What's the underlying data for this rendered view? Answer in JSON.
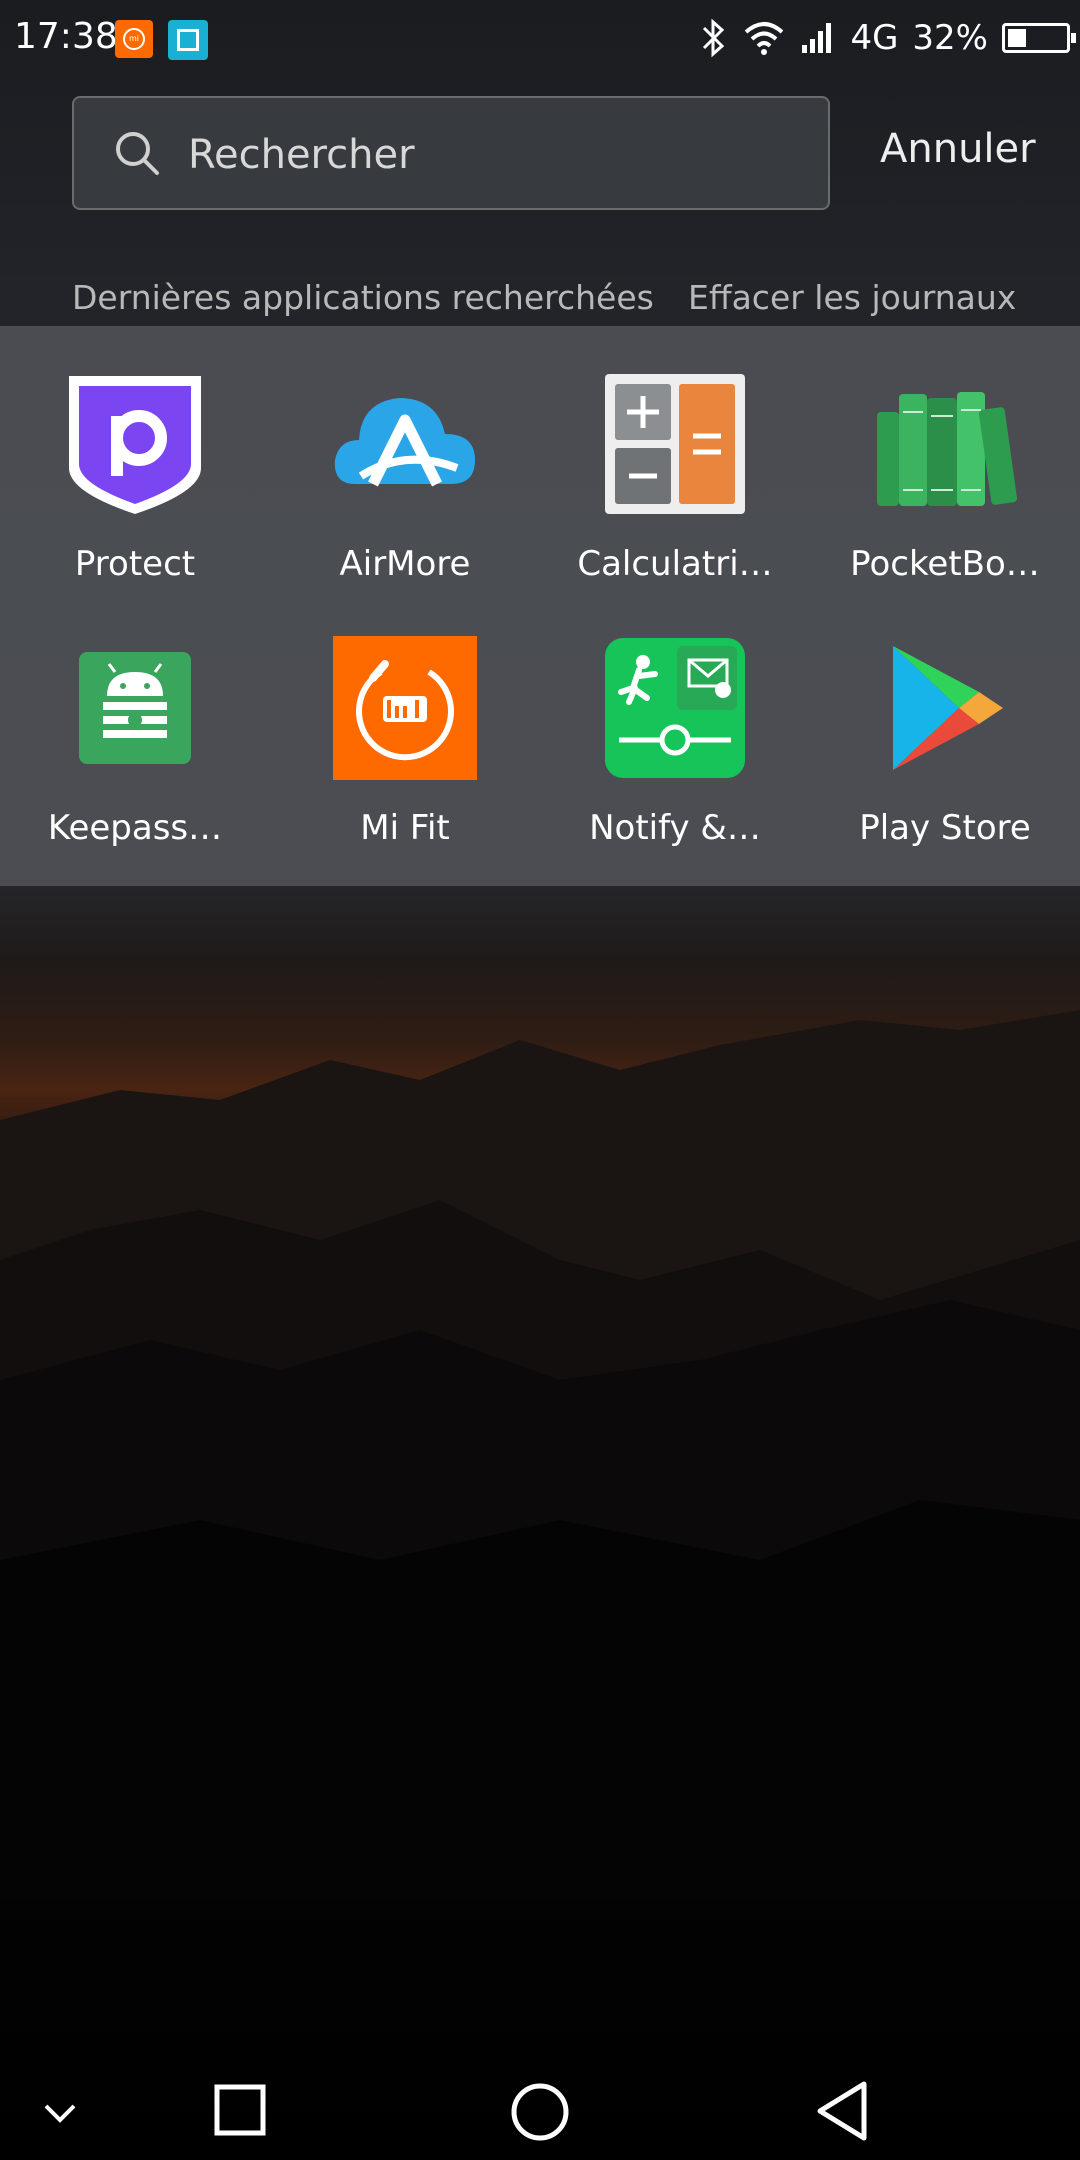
{
  "status_bar": {
    "time": "17:38",
    "network": "4G",
    "battery": "32%",
    "battery_level": 0.32,
    "icons": [
      "mi-notification-icon",
      "scanner-notification-icon",
      "bluetooth-icon",
      "wifi-icon",
      "signal-icon",
      "battery-icon"
    ]
  },
  "search": {
    "placeholder": "Rechercher",
    "cancel_label": "Annuler"
  },
  "recent": {
    "title": "Dernières applications recherchées",
    "clear_label": "Effacer les journaux"
  },
  "apps": [
    {
      "label": "Protect",
      "icon": "protect-icon"
    },
    {
      "label": "AirMore",
      "icon": "airmore-icon"
    },
    {
      "label": "Calculatri…",
      "icon": "calculator-icon"
    },
    {
      "label": "PocketBo…",
      "icon": "pocketbook-icon"
    },
    {
      "label": "Keepass…",
      "icon": "keepass-icon"
    },
    {
      "label": "Mi Fit",
      "icon": "mi-fit-icon"
    },
    {
      "label": "Notify &…",
      "icon": "notify-icon"
    },
    {
      "label": "Play Store",
      "icon": "play-store-icon"
    }
  ],
  "nav": {
    "icons": [
      "chevron-down-icon",
      "recents-square-icon",
      "home-circle-icon",
      "back-triangle-icon"
    ]
  }
}
